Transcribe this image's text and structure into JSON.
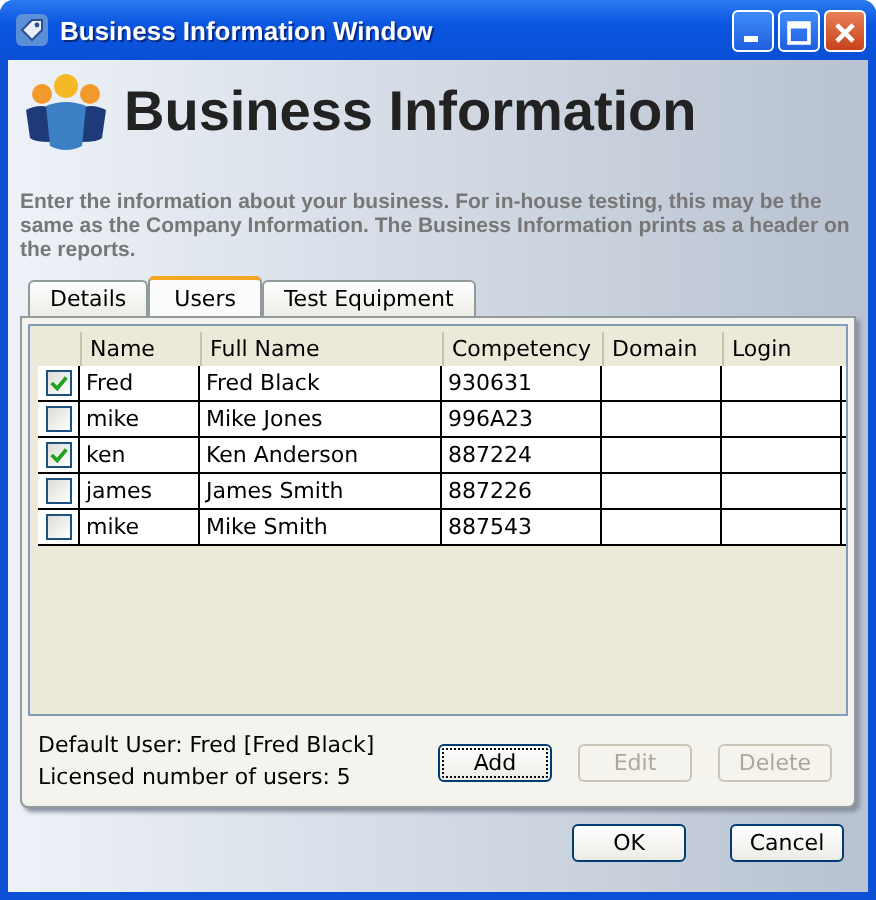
{
  "window": {
    "title": "Business Information Window"
  },
  "header": {
    "title": "Business Information",
    "description": "Enter the information about your business. For in-house testing, this may be the same as the Company Information. The Business Information prints as a header on the reports."
  },
  "tabs": [
    {
      "label": "Details",
      "selected": false
    },
    {
      "label": "Users",
      "selected": true
    },
    {
      "label": "Test Equipment",
      "selected": false
    }
  ],
  "table": {
    "columns": [
      "Name",
      "Full Name",
      "Competency",
      "Domain",
      "Login"
    ],
    "rows": [
      {
        "checked": true,
        "cells": [
          "Fred",
          "Fred Black",
          "930631",
          "",
          ""
        ]
      },
      {
        "checked": false,
        "cells": [
          "mike",
          "Mike Jones",
          "996A23",
          "",
          ""
        ]
      },
      {
        "checked": true,
        "cells": [
          "ken",
          "Ken Anderson",
          "887224",
          "",
          ""
        ]
      },
      {
        "checked": false,
        "cells": [
          "james",
          "James Smith",
          "887226",
          "",
          ""
        ]
      },
      {
        "checked": false,
        "cells": [
          "mike",
          "Mike Smith",
          "887543",
          "",
          ""
        ]
      }
    ]
  },
  "info": [
    "Default User: Fred [Fred Black]",
    "Licensed number of users: 5"
  ],
  "user_buttons": [
    {
      "label": "Add",
      "disabled": false
    },
    {
      "label": "Edit",
      "disabled": true
    },
    {
      "label": "Delete",
      "disabled": true
    }
  ],
  "buttons": [
    "OK",
    "Cancel"
  ]
}
